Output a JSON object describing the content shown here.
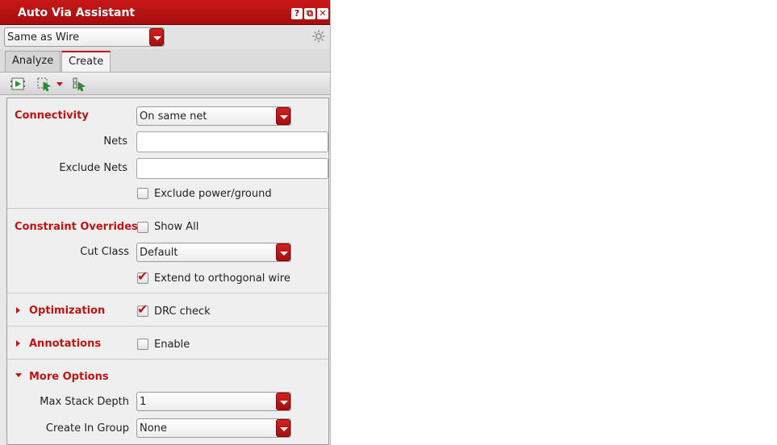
{
  "window": {
    "title": "Auto Via Assistant",
    "buttons": [
      "?",
      "⧉",
      "✕"
    ]
  },
  "mode": {
    "selected": "Same as Wire"
  },
  "tabs": [
    {
      "label": "Analyze",
      "active": false
    },
    {
      "label": "Create",
      "active": true
    }
  ],
  "toolbar": {
    "icons": [
      "run-icon",
      "select-region-icon",
      "dropdown-arrow-icon",
      "step-icon"
    ]
  },
  "connectivity": {
    "title": "Connectivity",
    "mode": "On same net",
    "nets_label": "Nets",
    "nets_value": "",
    "exclude_nets_label": "Exclude Nets",
    "exclude_nets_value": "",
    "exclude_power_label": "Exclude power/ground",
    "exclude_power_checked": false
  },
  "constraint_overrides": {
    "title": "Constraint Overrides",
    "show_all_label": "Show All",
    "show_all_checked": false,
    "cut_class_label": "Cut Class",
    "cut_class_value": "Default",
    "extend_label": "Extend to orthogonal wire",
    "extend_checked": true
  },
  "optimization": {
    "title": "Optimization",
    "expanded": false,
    "drc_label": "DRC check",
    "drc_checked": true
  },
  "annotations": {
    "title": "Annotations",
    "expanded": false,
    "enable_label": "Enable",
    "enable_checked": false
  },
  "more_options": {
    "title": "More Options",
    "expanded": true,
    "max_stack_label": "Max Stack Depth",
    "max_stack_value": "1",
    "create_group_label": "Create In Group",
    "create_group_value": "None"
  },
  "colors": {
    "accent": "#c01313",
    "title_bar": "#b31212",
    "panel_bg": "#efefef"
  }
}
